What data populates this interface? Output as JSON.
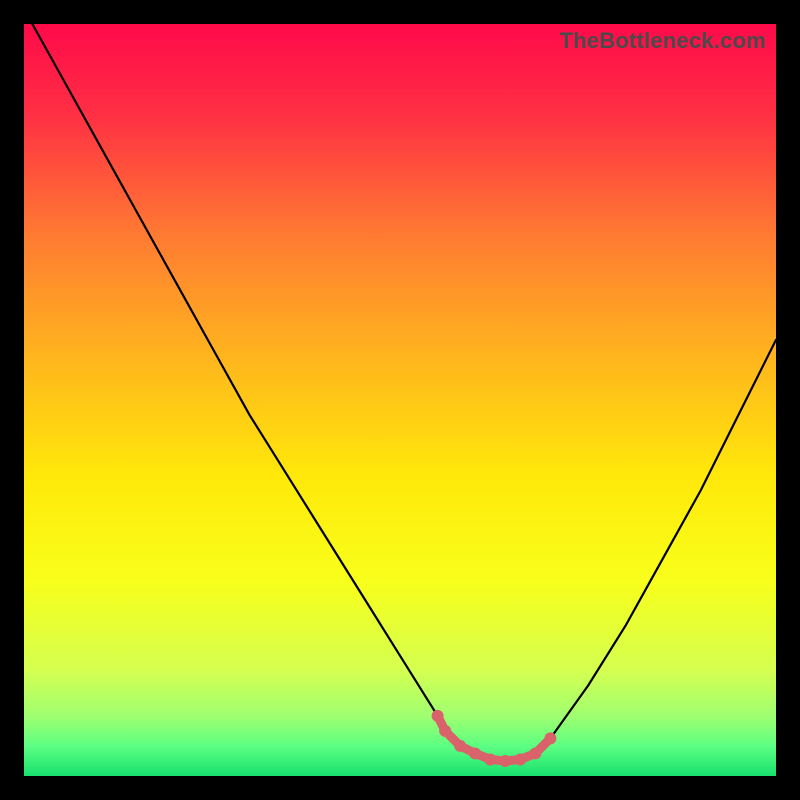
{
  "watermark": "TheBottleneck.com",
  "chart_data": {
    "type": "line",
    "title": "",
    "xlabel": "",
    "ylabel": "",
    "xlim": [
      0,
      100
    ],
    "ylim": [
      0,
      100
    ],
    "series": [
      {
        "name": "curve",
        "x": [
          0,
          5,
          10,
          15,
          20,
          25,
          30,
          35,
          40,
          45,
          50,
          55,
          56,
          58,
          60,
          62,
          64,
          66,
          68,
          70,
          75,
          80,
          85,
          90,
          95,
          100
        ],
        "values": [
          102,
          93,
          84,
          75,
          66,
          57,
          48,
          40,
          32,
          24,
          16,
          8,
          6,
          4,
          3,
          2.2,
          2,
          2.2,
          3,
          5,
          12,
          20,
          29,
          38,
          48,
          58
        ]
      },
      {
        "name": "floor_highlight",
        "x": [
          55,
          56,
          58,
          60,
          62,
          64,
          66,
          68,
          70
        ],
        "values": [
          8,
          6,
          4,
          3,
          2.2,
          2,
          2.2,
          3,
          5
        ]
      }
    ],
    "gradient_stops": [
      {
        "pos": 0.0,
        "color": "#ff0a4a"
      },
      {
        "pos": 0.12,
        "color": "#ff2f44"
      },
      {
        "pos": 0.28,
        "color": "#ff7a32"
      },
      {
        "pos": 0.44,
        "color": "#ffb41e"
      },
      {
        "pos": 0.6,
        "color": "#ffe80a"
      },
      {
        "pos": 0.74,
        "color": "#f8ff1a"
      },
      {
        "pos": 0.86,
        "color": "#d4ff50"
      },
      {
        "pos": 0.92,
        "color": "#a0ff70"
      },
      {
        "pos": 0.96,
        "color": "#5cff82"
      },
      {
        "pos": 1.0,
        "color": "#18e06e"
      }
    ],
    "styles": {
      "curve": {
        "stroke": "#000000",
        "width": 2.2
      },
      "floor_highlight": {
        "stroke": "#d9626b",
        "width": 9,
        "dots_r": 6
      }
    }
  }
}
